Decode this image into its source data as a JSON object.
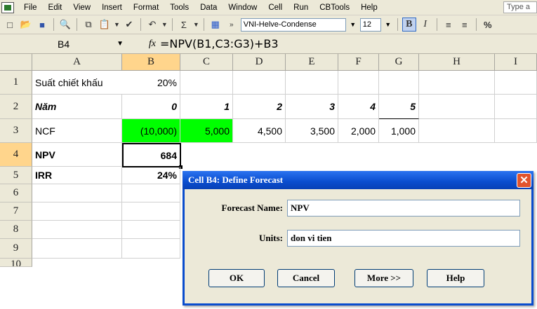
{
  "menubar": {
    "items": [
      "File",
      "Edit",
      "View",
      "Insert",
      "Format",
      "Tools",
      "Data",
      "Window",
      "Cell",
      "Run",
      "CBTools",
      "Help"
    ],
    "type_question": "Type a"
  },
  "toolbar": {
    "font_name": "VNI-Helve-Condense",
    "font_size": "12",
    "bold_label": "B",
    "italic_label": "I",
    "percent_label": "%"
  },
  "formula_bar": {
    "name_box": "B4",
    "fx_label": "fx",
    "formula": "=NPV(B1,C3:G3)+B3"
  },
  "sheet": {
    "columns": [
      "A",
      "B",
      "C",
      "D",
      "E",
      "F",
      "G",
      "H",
      "I"
    ],
    "rows": [
      "1",
      "2",
      "3",
      "4",
      "5",
      "6",
      "7",
      "8",
      "9",
      "10"
    ],
    "r1": {
      "a": "Suất chiết khấu",
      "b": "20%"
    },
    "r2": {
      "a": "Năm",
      "b": "0",
      "c": "1",
      "d": "2",
      "e": "3",
      "f": "4",
      "g": "5"
    },
    "r3": {
      "a": "NCF",
      "b": "(10,000)",
      "c": "5,000",
      "d": "4,500",
      "e": "3,500",
      "f": "2,000",
      "g": "1,000"
    },
    "r4": {
      "a": "NPV",
      "b": "684"
    },
    "r5": {
      "a": "IRR",
      "b": "24%"
    }
  },
  "dialog": {
    "title": "Cell B4: Define Forecast",
    "forecast_name_label": "Forecast Name:",
    "forecast_name_value": "NPV",
    "units_label": "Units:",
    "units_value": "don vi tien",
    "ok": "OK",
    "cancel": "Cancel",
    "more": "More >>",
    "help": "Help"
  },
  "colors": {
    "selection_header": "#ffd58c",
    "green_fill": "#00ff00",
    "title_bar": "#0a4dce"
  }
}
